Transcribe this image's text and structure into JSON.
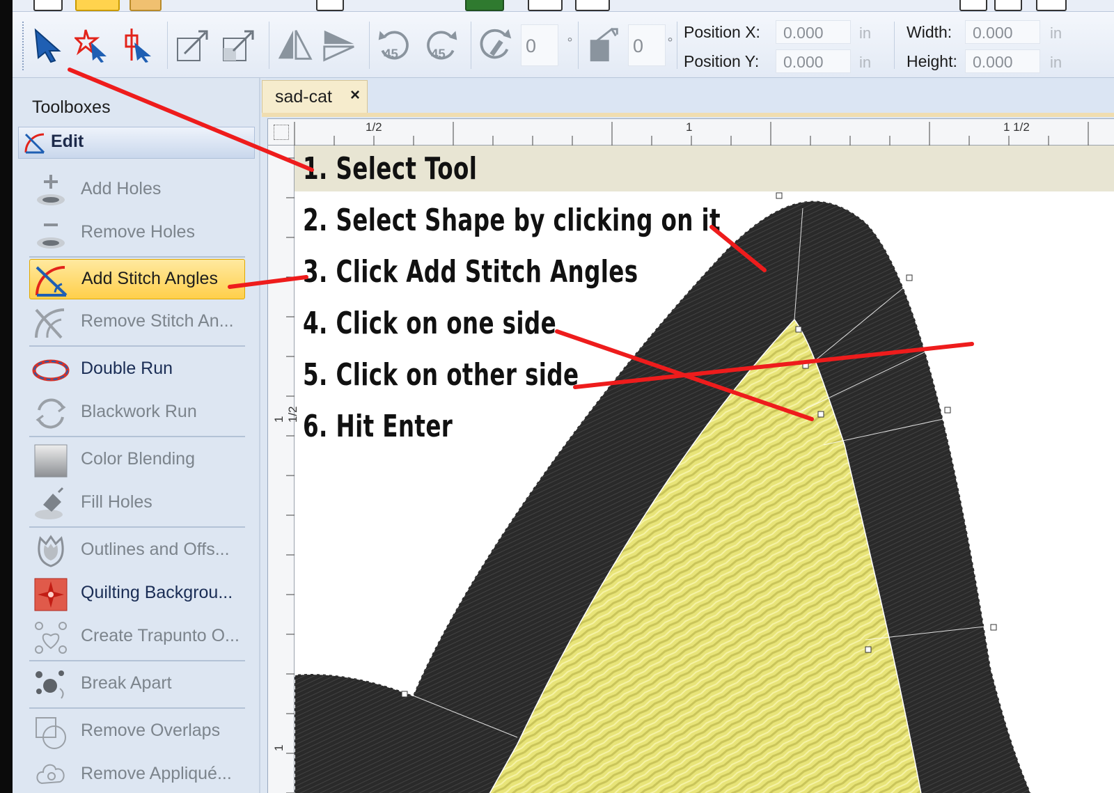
{
  "toolbar": {
    "angle_value_1": "0",
    "angle_value_2": "0",
    "degree_symbol": "°",
    "rotate_ccw_label": "45",
    "rotate_cw_label": "45",
    "position_x_label": "Position X:",
    "position_y_label": "Position Y:",
    "position_x_value": "0.000",
    "position_y_value": "0.000",
    "width_label": "Width:",
    "height_label": "Height:",
    "width_value": "0.000",
    "height_value": "0.000",
    "unit": "in"
  },
  "sidebar": {
    "title": "Toolboxes",
    "section": "Edit",
    "items": [
      {
        "label": "Add Holes",
        "icon": "add-holes-icon",
        "state": "disabled"
      },
      {
        "label": "Remove Holes",
        "icon": "remove-holes-icon",
        "state": "disabled"
      },
      {
        "label": "Add Stitch Angles",
        "icon": "add-stitch-angles-icon",
        "state": "highlighted"
      },
      {
        "label": "Remove Stitch An...",
        "icon": "remove-stitch-angles-icon",
        "state": "disabled"
      },
      {
        "label": "Double Run",
        "icon": "double-run-icon",
        "state": "active"
      },
      {
        "label": "Blackwork Run",
        "icon": "blackwork-run-icon",
        "state": "disabled"
      },
      {
        "label": "Color Blending",
        "icon": "color-blending-icon",
        "state": "disabled"
      },
      {
        "label": "Fill Holes",
        "icon": "fill-holes-icon",
        "state": "disabled"
      },
      {
        "label": "Outlines and Offs...",
        "icon": "outlines-icon",
        "state": "disabled"
      },
      {
        "label": "Quilting Backgrou...",
        "icon": "quilting-background-icon",
        "state": "active"
      },
      {
        "label": "Create Trapunto O...",
        "icon": "trapunto-icon",
        "state": "disabled"
      },
      {
        "label": "Break Apart",
        "icon": "break-apart-icon",
        "state": "disabled"
      },
      {
        "label": "Remove Overlaps",
        "icon": "remove-overlaps-icon",
        "state": "disabled"
      },
      {
        "label": "Remove Appliqué...",
        "icon": "remove-applique-icon",
        "state": "disabled"
      }
    ]
  },
  "document": {
    "tab_name": "sad-cat",
    "close_symbol": "×"
  },
  "rulers": {
    "h_half": "1/2",
    "h_one": "1",
    "h_one_half": "1 1/2",
    "v_one_half": "1 1/2",
    "v_one": "1"
  },
  "instructions": [
    "1. Select Tool",
    "2. Select Shape by clicking on it",
    "3. Click Add Stitch Angles",
    "4. Click on one side",
    "5. Click on other side",
    "6. Hit Enter"
  ],
  "colors": {
    "annotation_red": "#ee1c1c",
    "thread_black": "#2b2b2b",
    "thread_yellow": "#e9e57a",
    "highlight": "#ffd34d",
    "instruction_band": "#e8e5d3"
  }
}
